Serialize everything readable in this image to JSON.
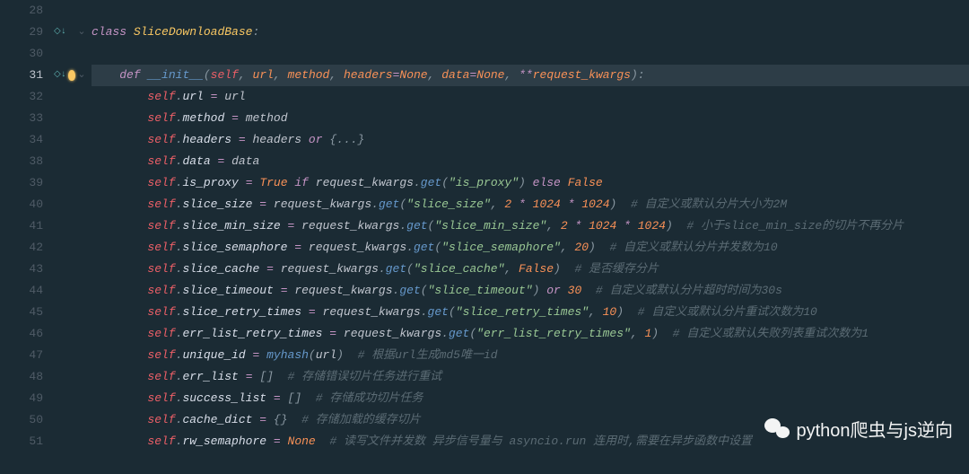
{
  "watermark": "python爬虫与js逆向",
  "lines": [
    {
      "num": 28,
      "fold": "",
      "marker": "",
      "html": ""
    },
    {
      "num": 29,
      "fold": "⌄",
      "marker": "bp",
      "html": "<span class='kw'>class</span> <span class='cls'>SliceDownloadBase</span><span class='punct'>:</span>"
    },
    {
      "num": 30,
      "fold": "",
      "marker": "",
      "html": ""
    },
    {
      "num": 31,
      "fold": "⌄",
      "marker": "bp bulb",
      "current": true,
      "html": "    <span class='kw'>def</span> <span class='fn'>__init__</span><span class='punct'>(</span><span class='self'>self</span><span class='punct'>,</span> <span class='param'>url</span><span class='punct'>,</span> <span class='param'>method</span><span class='punct'>,</span> <span class='param'>headers</span><span class='op'>=</span><span class='const'>None</span><span class='punct'>,</span> <span class='param'>data</span><span class='op'>=</span><span class='const'>None</span><span class='punct'>,</span> <span class='op'>**</span><span class='param'>request_kwargs</span><span class='punct'>):</span>"
    },
    {
      "num": 32,
      "fold": "",
      "marker": "",
      "html": "        <span class='self'>self</span><span class='punct'>.</span><span class='prop'>url</span> <span class='op'>=</span> <span class='default'>url</span>"
    },
    {
      "num": 33,
      "fold": "",
      "marker": "",
      "html": "        <span class='self'>self</span><span class='punct'>.</span><span class='prop'>method</span> <span class='op'>=</span> <span class='default'>method</span>"
    },
    {
      "num": 34,
      "fold": "",
      "marker": "",
      "html": "        <span class='self'>self</span><span class='punct'>.</span><span class='prop'>headers</span> <span class='op'>=</span> <span class='default'>headers</span> <span class='kw'>or</span> <span class='punct'>{...}</span>"
    },
    {
      "num": 38,
      "fold": "",
      "marker": "",
      "html": "        <span class='self'>self</span><span class='punct'>.</span><span class='prop'>data</span> <span class='op'>=</span> <span class='default'>data</span>"
    },
    {
      "num": 39,
      "fold": "",
      "marker": "",
      "html": "        <span class='self'>self</span><span class='punct'>.</span><span class='prop'>is_proxy</span> <span class='op'>=</span> <span class='const'>True</span> <span class='kw'>if</span> <span class='default'>request_kwargs</span><span class='punct'>.</span><span class='fn'>get</span><span class='punct'>(</span><span class='str'>\"is_proxy\"</span><span class='punct'>)</span> <span class='kw'>else</span> <span class='const'>False</span>"
    },
    {
      "num": 40,
      "fold": "",
      "marker": "",
      "html": "        <span class='self'>self</span><span class='punct'>.</span><span class='prop'>slice_size</span> <span class='op'>=</span> <span class='default'>request_kwargs</span><span class='punct'>.</span><span class='fn'>get</span><span class='punct'>(</span><span class='str'>\"slice_size\"</span><span class='punct'>,</span> <span class='const'>2</span> <span class='op'>*</span> <span class='const'>1024</span> <span class='op'>*</span> <span class='const'>1024</span><span class='punct'>)</span>  <span class='cmt'># 自定义或默认分片大小为2M</span>"
    },
    {
      "num": 41,
      "fold": "",
      "marker": "",
      "html": "        <span class='self'>self</span><span class='punct'>.</span><span class='prop'>slice_min_size</span> <span class='op'>=</span> <span class='default'>request_kwargs</span><span class='punct'>.</span><span class='fn'>get</span><span class='punct'>(</span><span class='str'>\"slice_min_size\"</span><span class='punct'>,</span> <span class='const'>2</span> <span class='op'>*</span> <span class='const'>1024</span> <span class='op'>*</span> <span class='const'>1024</span><span class='punct'>)</span>  <span class='cmt'># 小于slice_min_size的切片不再分片</span>"
    },
    {
      "num": 42,
      "fold": "",
      "marker": "",
      "html": "        <span class='self'>self</span><span class='punct'>.</span><span class='prop'>slice_semaphore</span> <span class='op'>=</span> <span class='default'>request_kwargs</span><span class='punct'>.</span><span class='fn'>get</span><span class='punct'>(</span><span class='str'>\"slice_semaphore\"</span><span class='punct'>,</span> <span class='const'>20</span><span class='punct'>)</span>  <span class='cmt'># 自定义或默认分片并发数为10</span>"
    },
    {
      "num": 43,
      "fold": "",
      "marker": "",
      "html": "        <span class='self'>self</span><span class='punct'>.</span><span class='prop'>slice_cache</span> <span class='op'>=</span> <span class='default'>request_kwargs</span><span class='punct'>.</span><span class='fn'>get</span><span class='punct'>(</span><span class='str'>\"slice_cache\"</span><span class='punct'>,</span> <span class='const'>False</span><span class='punct'>)</span>  <span class='cmt'># 是否缓存分片</span>"
    },
    {
      "num": 44,
      "fold": "",
      "marker": "",
      "html": "        <span class='self'>self</span><span class='punct'>.</span><span class='prop'>slice_timeout</span> <span class='op'>=</span> <span class='default'>request_kwargs</span><span class='punct'>.</span><span class='fn'>get</span><span class='punct'>(</span><span class='str'>\"slice_timeout\"</span><span class='punct'>)</span> <span class='kw'>or</span> <span class='const'>30</span>  <span class='cmt'># 自定义或默认分片超时时间为30s</span>"
    },
    {
      "num": 45,
      "fold": "",
      "marker": "",
      "html": "        <span class='self'>self</span><span class='punct'>.</span><span class='prop'>slice_retry_times</span> <span class='op'>=</span> <span class='default'>request_kwargs</span><span class='punct'>.</span><span class='fn'>get</span><span class='punct'>(</span><span class='str'>\"slice_retry_times\"</span><span class='punct'>,</span> <span class='const'>10</span><span class='punct'>)</span>  <span class='cmt'># 自定义或默认分片重试次数为10</span>"
    },
    {
      "num": 46,
      "fold": "",
      "marker": "",
      "html": "        <span class='self'>self</span><span class='punct'>.</span><span class='prop'>err_list_retry_times</span> <span class='op'>=</span> <span class='default'>request_kwargs</span><span class='punct'>.</span><span class='fn'>get</span><span class='punct'>(</span><span class='str'>\"err_list_retry_times\"</span><span class='punct'>,</span> <span class='const'>1</span><span class='punct'>)</span>  <span class='cmt'># 自定义或默认失败列表重试次数为1</span>"
    },
    {
      "num": 47,
      "fold": "",
      "marker": "",
      "html": "        <span class='self'>self</span><span class='punct'>.</span><span class='prop'>unique_id</span> <span class='op'>=</span> <span class='fn'>myhash</span><span class='punct'>(</span><span class='default'>url</span><span class='punct'>)</span>  <span class='cmt'># 根据url生成md5唯一id</span>"
    },
    {
      "num": 48,
      "fold": "",
      "marker": "",
      "html": "        <span class='self'>self</span><span class='punct'>.</span><span class='prop'>err_list</span> <span class='op'>=</span> <span class='punct'>[]</span>  <span class='cmt'># 存储错误切片任务进行重试</span>"
    },
    {
      "num": 49,
      "fold": "",
      "marker": "",
      "html": "        <span class='self'>self</span><span class='punct'>.</span><span class='prop'>success_list</span> <span class='op'>=</span> <span class='punct'>[]</span>  <span class='cmt'># 存储成功切片任务</span>"
    },
    {
      "num": 50,
      "fold": "",
      "marker": "",
      "html": "        <span class='self'>self</span><span class='punct'>.</span><span class='prop'>cache_dict</span> <span class='op'>=</span> <span class='punct'>{}</span>  <span class='cmt'># 存储加载的缓存切片</span>"
    },
    {
      "num": 51,
      "fold": "",
      "marker": "",
      "html": "        <span class='self'>self</span><span class='punct'>.</span><span class='prop'>rw_semaphore</span> <span class='op'>=</span> <span class='const'>None</span>  <span class='cmt'># 读写文件并发数 异步信号量与 asyncio.run 连用时,需要在异步函数中设置</span>"
    },
    {
      "num": "",
      "fold": "",
      "marker": "",
      "html": ""
    }
  ]
}
